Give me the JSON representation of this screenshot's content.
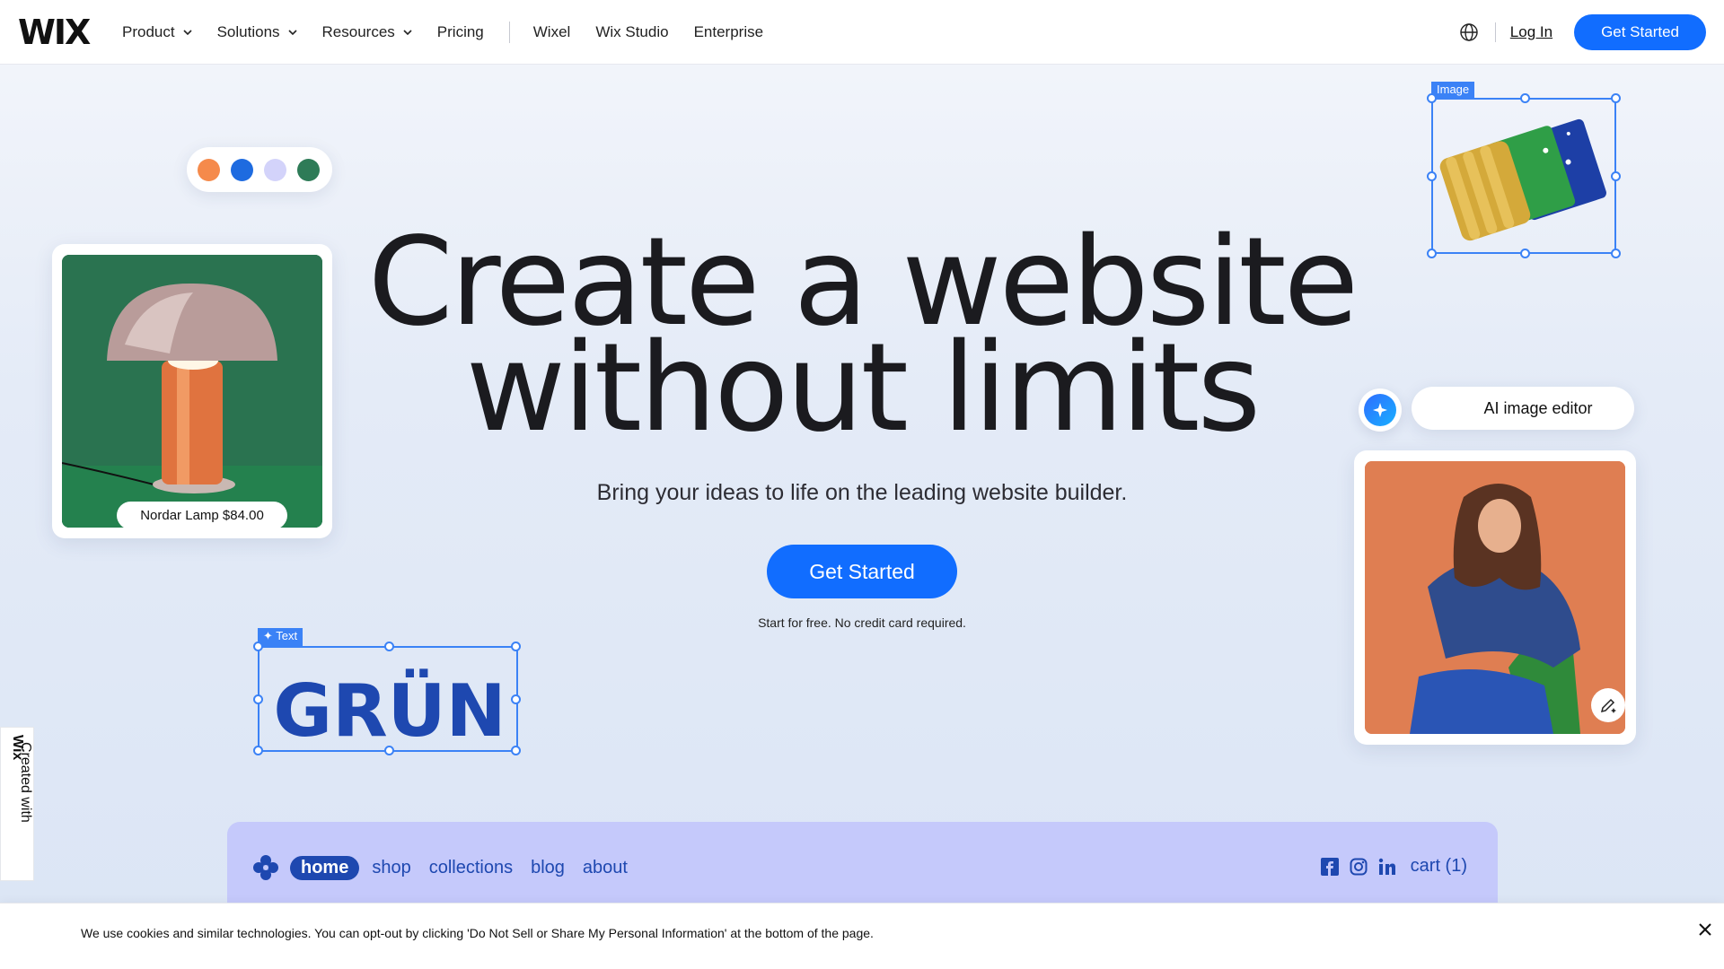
{
  "nav": {
    "logo": "WIX",
    "items": [
      {
        "label": "Product",
        "has_dropdown": true
      },
      {
        "label": "Solutions",
        "has_dropdown": true
      },
      {
        "label": "Resources",
        "has_dropdown": true
      },
      {
        "label": "Pricing",
        "has_dropdown": false
      }
    ],
    "items2": [
      "Wixel",
      "Wix Studio",
      "Enterprise"
    ],
    "login": "Log In",
    "cta": "Get Started"
  },
  "palette": {
    "dots": [
      "#f58a4b",
      "#1e6be0",
      "#d3d3fa",
      "#2e7b57"
    ]
  },
  "lamp_card": {
    "tag": "Nordar Lamp $84.00"
  },
  "hero": {
    "title_line1": "Create a website",
    "title_line2": "without limits",
    "subtitle": "Bring your ideas to life on the leading website builder.",
    "cta": "Get Started",
    "note": "Start for free. No credit card required."
  },
  "image_frame": {
    "tag": "Image"
  },
  "ai_editor": {
    "label": "AI image editor"
  },
  "text_frame": {
    "tag": "Text",
    "content": "GRÜN"
  },
  "preview": {
    "nav": [
      "home",
      "shop",
      "collections",
      "blog",
      "about"
    ],
    "active": "home",
    "cart": "cart (1)"
  },
  "side_badge": {
    "text": "Created with ",
    "brand": "Wix"
  },
  "cookie": {
    "text": "We use cookies and similar technologies. You can opt-out by clicking 'Do Not Sell or Share My Personal Information' at the bottom of the page."
  },
  "colors": {
    "accent": "#116dff",
    "frame": "#3b82f6",
    "preview_bg": "#c5c9fb",
    "preview_text": "#1e48b0"
  }
}
